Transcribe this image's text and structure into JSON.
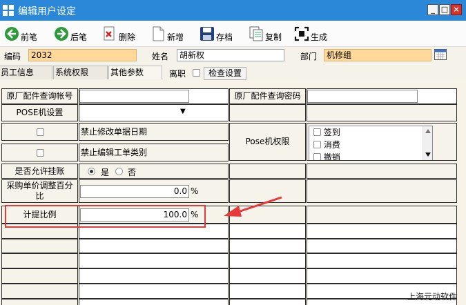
{
  "window": {
    "title": "编辑用户设定",
    "minimize_glyph": "_",
    "maximize_glyph": "□",
    "close_glyph": "×"
  },
  "toolbar": [
    {
      "id": "prev",
      "label": "前笔",
      "icon": "arrow-left-icon"
    },
    {
      "id": "next",
      "label": "后笔",
      "icon": "arrow-right-icon"
    },
    {
      "id": "delete",
      "label": "删除",
      "icon": "delete-icon"
    },
    {
      "id": "add",
      "label": "新增",
      "icon": "new-document-icon"
    },
    {
      "id": "save",
      "label": "存档",
      "icon": "save-icon"
    },
    {
      "id": "copy",
      "label": "复制",
      "icon": "copy-icon"
    },
    {
      "id": "generate",
      "label": "生成",
      "icon": "generate-icon"
    }
  ],
  "info": {
    "code_label": "编码",
    "code_value": "2032",
    "name_label": "姓名",
    "name_value": "胡新权",
    "dept_label": "部门",
    "dept_value": "机修组"
  },
  "tabs": [
    {
      "label": "员工信息",
      "active": false
    },
    {
      "label": "系统权限",
      "active": false
    },
    {
      "label": "其他参数",
      "active": true
    }
  ],
  "resign_label": "离职",
  "check_settings_label": "检查设置",
  "grid": {
    "oem_account_label": "原厂配件查询帐号",
    "oem_password_label": "原厂配件查询密码",
    "pose_setting_label": "POSE机设置",
    "dropdown_glyph": "▼",
    "forbid_edit_date_label": "禁止修改单据日期",
    "forbid_edit_type_label": "禁止编辑工单类别",
    "pose_permission_label": "Pose机权限",
    "pose_permission_items": [
      "签到",
      "消费",
      "撤销"
    ],
    "allow_credit_label": "是否允许挂账",
    "yes_label": "是",
    "no_label": "否",
    "purchase_adjust_label_1": "采购单价调整百分",
    "purchase_adjust_label_2": "比",
    "purchase_adjust_value": "0.0",
    "commission_label": "计提比例",
    "commission_value": "100.0",
    "percent": "%"
  },
  "watermark": "上海元动软件",
  "colors": {
    "titlebar": "#2b88d8",
    "highlight": "#e83a3a",
    "field_orange": "#ffd89a"
  }
}
